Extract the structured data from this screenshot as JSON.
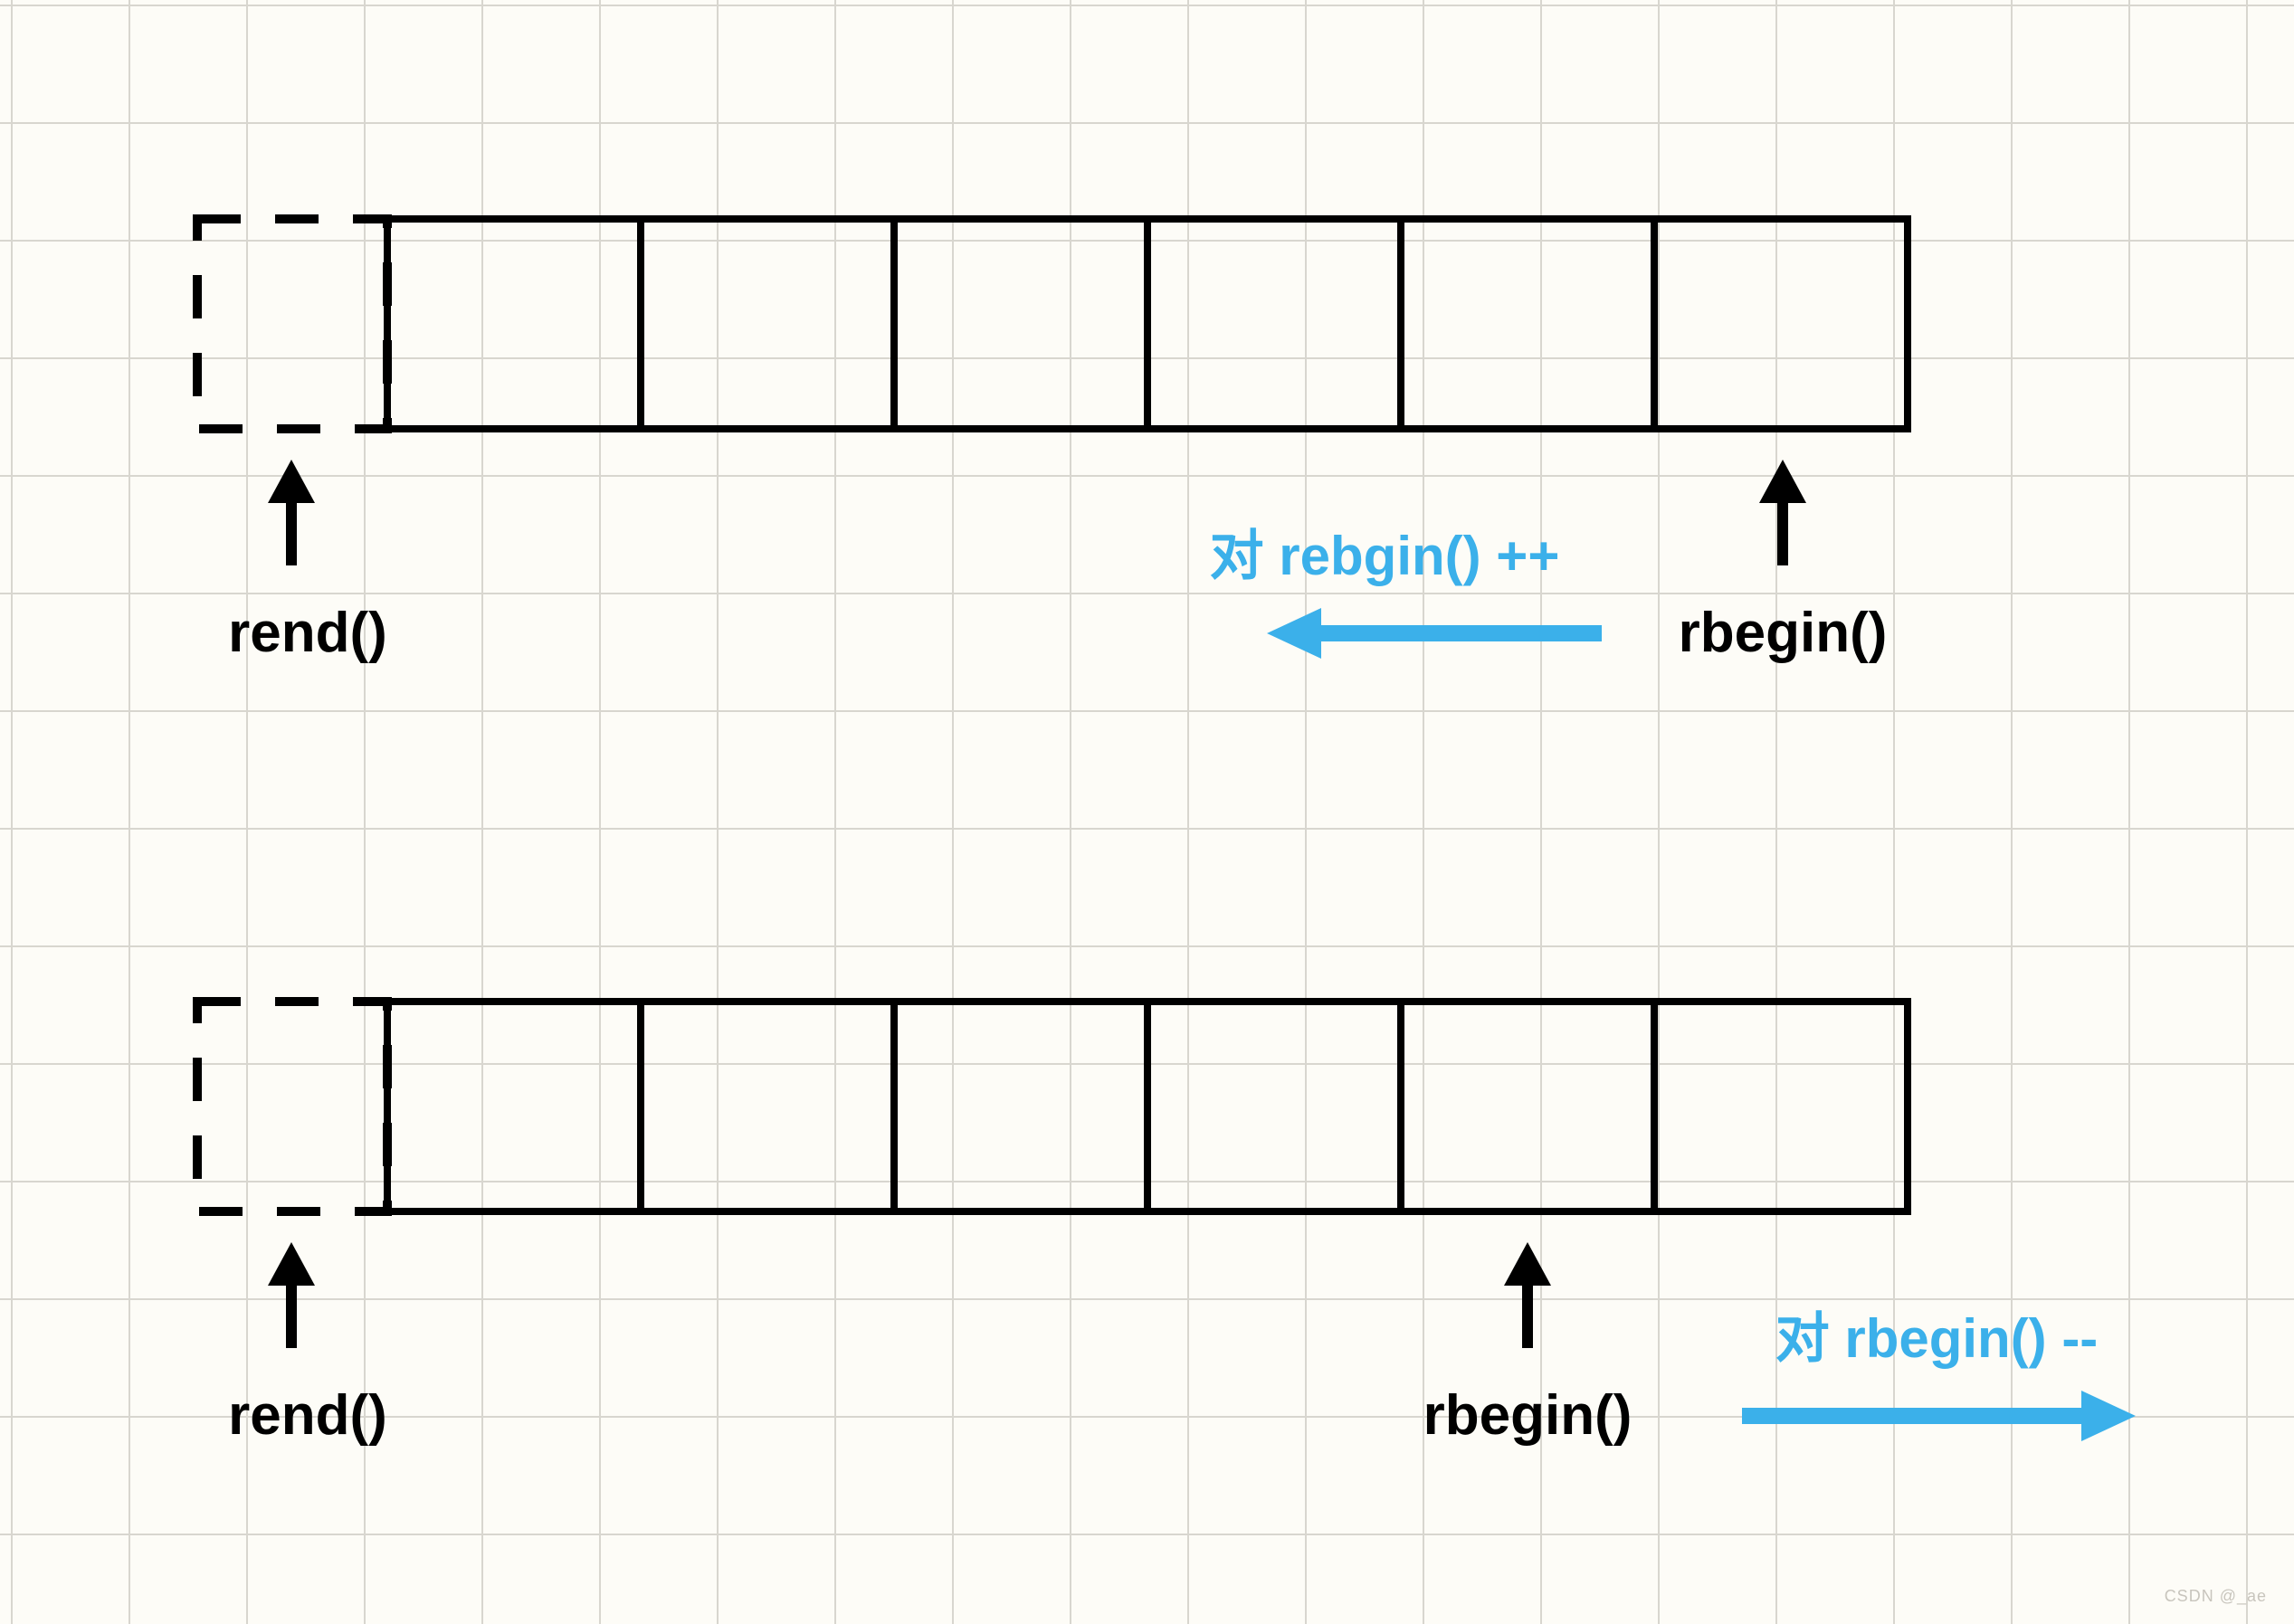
{
  "diagrams": [
    {
      "rend_label": "rend()",
      "rbegin_label": "rbegin()",
      "arrow_label": "对 rebgin() ++",
      "rbegin_cell_index": 5,
      "arrow_direction": "left",
      "cells": 6
    },
    {
      "rend_label": "rend()",
      "rbegin_label": "rbegin()",
      "arrow_label": "对 rbegin() --",
      "rbegin_cell_index": 4,
      "arrow_direction": "right",
      "cells": 6
    }
  ],
  "colors": {
    "accent_blue": "#3bb0ea",
    "ink": "#000000",
    "paper": "#fdfcf7",
    "grid": "#d8d6cf"
  },
  "watermark": "CSDN @_ae"
}
